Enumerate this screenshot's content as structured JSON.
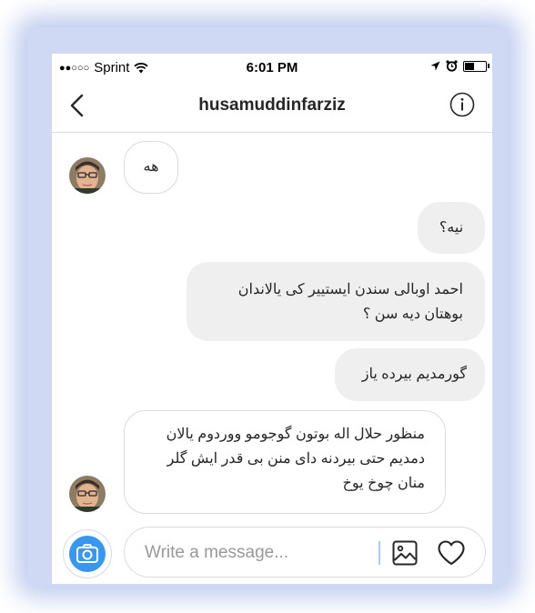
{
  "status_bar": {
    "signal": "●●○○○",
    "carrier": "Sprint",
    "wifi_icon": "wifi-icon",
    "time": "6:01 PM",
    "location_icon": "location-arrow-icon",
    "alarm_icon": "alarm-clock-icon",
    "battery_level": 0.45
  },
  "header": {
    "back_icon": "chevron-left-icon",
    "username": "husamuddinfarziz",
    "info_icon": "info-icon"
  },
  "messages": [
    {
      "direction": "incoming",
      "text": "هه"
    },
    {
      "direction": "outgoing",
      "text": "نیه؟"
    },
    {
      "direction": "outgoing",
      "lines": [
        "احمد اوبالی سندن ایستییر کی یالاندان",
        "بوهتان دیه سن ؟"
      ]
    },
    {
      "direction": "outgoing",
      "text": "گورمدیم بیرده یاز"
    },
    {
      "direction": "incoming",
      "lines": [
        "منظور حلال اله بوتون گوجومو ووردوم یالان",
        "دمدیم حتی بیردنه دای منن بی قدر ایش گلر",
        "منان چوخ یوخ"
      ]
    }
  ],
  "composer": {
    "camera_icon": "camera-icon",
    "placeholder": "Write a message...",
    "gallery_icon": "image-gallery-icon",
    "heart_icon": "heart-icon"
  },
  "colors": {
    "accent": "#3897f0",
    "outgoing_bubble": "#efefef",
    "border": "#dbdbdb",
    "halo": "#cfd9f3"
  }
}
